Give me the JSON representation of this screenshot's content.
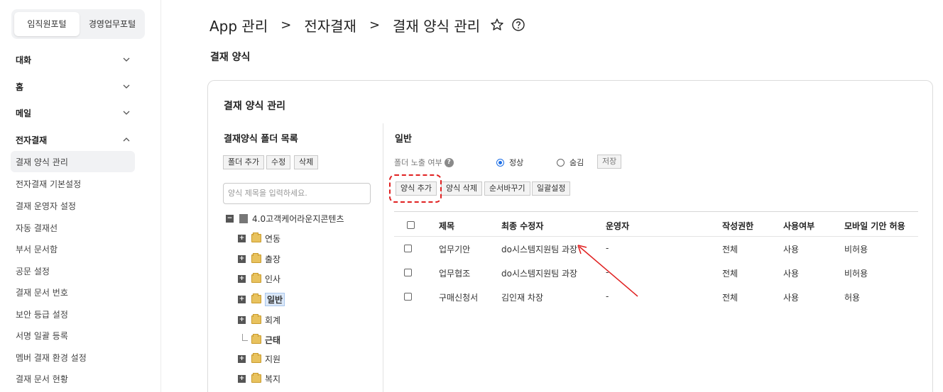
{
  "sidebar": {
    "portal_tabs": [
      "임직원포털",
      "경영업무포털"
    ],
    "groups": [
      "대화",
      "홈",
      "메일",
      "전자결재"
    ],
    "items": [
      "결재 양식 관리",
      "전자결재 기본설정",
      "결재 운영자 설정",
      "자동 결재선",
      "부서 문서함",
      "공문 설정",
      "결재 문서 번호",
      "보안 등급 설정",
      "서명 일괄 등록",
      "멤버 결재 환경 설정",
      "결재 문서 현황"
    ]
  },
  "header": {
    "breadcrumb": [
      "App 관리",
      "전자결재",
      "결재 양식 관리"
    ],
    "separator": ">",
    "subtitle": "결재 양식"
  },
  "panel": {
    "title": "결재 양식 관리",
    "folder_list": {
      "title": "결재양식 폴더 목록",
      "buttons": [
        "폴더 추가",
        "수정",
        "삭제"
      ],
      "search_placeholder": "양식 제목을 입력하세요.",
      "root": "4.0고객케어라운지콘텐츠",
      "folders": [
        "연동",
        "출장",
        "인사",
        "일반",
        "회계",
        "근태",
        "지원",
        "복지"
      ]
    },
    "detail": {
      "title": "일반",
      "expose_label": "폴더 노출 여부",
      "help_glyph": "?",
      "radio_options": [
        "정상",
        "숨김"
      ],
      "radio_selected": "정상",
      "save_button": "저장",
      "action_buttons": [
        "양식 추가",
        "양식 삭제",
        "순서바꾸기",
        "일괄설정"
      ],
      "table": {
        "columns": [
          "제목",
          "최종 수정자",
          "운영자",
          "작성권한",
          "사용여부",
          "모바일 기안 허용"
        ],
        "rows": [
          [
            "업무기안",
            "do시스템지원팀 과장",
            "-",
            "전체",
            "사용",
            "비허용"
          ],
          [
            "업무협조",
            "do시스템지원팀 과장",
            "-",
            "전체",
            "사용",
            "비허용"
          ],
          [
            "구매신청서",
            "김인재 차장",
            "-",
            "전체",
            "사용",
            "허용"
          ]
        ]
      }
    }
  },
  "colors": {
    "annotation_red": "#e02020",
    "radio_blue": "#1e6fe6",
    "selected_bg": "#dbe8f8"
  }
}
